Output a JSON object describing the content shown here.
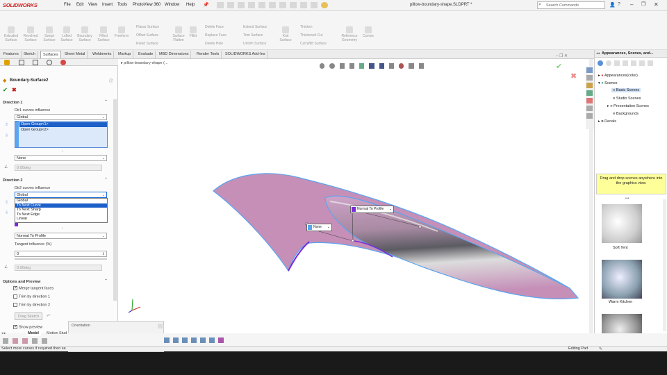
{
  "app": {
    "logo": "SOLIDWORKS",
    "title": "pillow-boundary-shape.SLDPRT *",
    "search_placeholder": "Search Commands"
  },
  "menu": [
    "File",
    "Edit",
    "View",
    "Insert",
    "Tools",
    "PhotoView 360",
    "Window",
    "Help"
  ],
  "cmd": {
    "extruded": "Extruded Surface",
    "revolved": "Revolved Surface",
    "swept": "Swept Surface",
    "lofted": "Lofted Surface",
    "boundary": "Boundary Surface",
    "filled": "Filled Surface",
    "freeform": "Freeform",
    "planar": "Planar Surface",
    "offset": "Offset Surface",
    "ruled": "Ruled Surface",
    "flatten": "Surface Flatten",
    "fillet": "Fillet",
    "delete_face": "Delete Face",
    "replace_face": "Replace Face",
    "delete_hole": "Delete Hole",
    "extend": "Extend Surface",
    "trim": "Trim Surface",
    "untrim": "Untrim Surface",
    "knit": "Knit Surface",
    "thicken": "Thicken",
    "thickened_cut": "Thickened Cut",
    "cut_with_surface": "Cut With Surface",
    "ref_geom": "Reference Geometry",
    "curves": "Curves"
  },
  "tabs": [
    "Features",
    "Sketch",
    "Surfaces",
    "Sheet Metal",
    "Weldments",
    "Markup",
    "Evaluate",
    "MBD Dimensions",
    "Render Tools",
    "SOLIDWORKS Add-Ins"
  ],
  "breadcrumb": "pillow-boundary-shape (...",
  "pm": {
    "title": "Boundary-Surface2",
    "dir1": {
      "header": "Direction 1",
      "influence_label": "Dir1 curves influence",
      "influence_value": "Global",
      "list": [
        "Open Group<1>",
        "Open Group<2>"
      ],
      "tangent": "None",
      "angle": "0.00deg"
    },
    "dir2": {
      "header": "Direction 2",
      "influence_label": "Dir2 curves influence",
      "influence_value": "Global",
      "dropdown": [
        "Global",
        "To Next Curve",
        "To Next Sharp",
        "To Next Edge",
        "Linear"
      ],
      "tangent": "Normal To Profile",
      "tangent_label": "Tangent influence (%)",
      "tangent_pct": "0",
      "angle": "0.00deg"
    },
    "options": {
      "header": "Options and Preview",
      "merge": "Merge tangent faces",
      "trim1": "Trim by direction 1",
      "trim2": "Trim by direction 2",
      "drag": "Drag Sketch",
      "show_preview": "Show preview"
    }
  },
  "callouts": {
    "none": "None",
    "normal": "Normal To Profile"
  },
  "orientation": "Orientation",
  "bottom_tabs": [
    "Model",
    "Motion Stud"
  ],
  "status": {
    "left": "Select more curves if required then se",
    "right": "Editing Part"
  },
  "taskpane": {
    "title": "Appearances, Scenes, and...",
    "tree": [
      "Appearances(color)",
      "Scenes",
      "Basic Scenes",
      "Studio Scenes",
      "Presentation Scenes",
      "Backgrounds",
      "Decals"
    ],
    "hint": "Drag and drop scenes anywhere into the graphics view.",
    "thumbs": [
      "Soft Tent",
      "Warm Kitchen"
    ]
  },
  "colors": {
    "accent": "#1c6fd6",
    "selected_bg": "#1c5fc8",
    "hint_bg": "#ffff99",
    "surface": "#c58fb8",
    "edge": "#5aa6f0",
    "brand": "#d11c1c"
  }
}
